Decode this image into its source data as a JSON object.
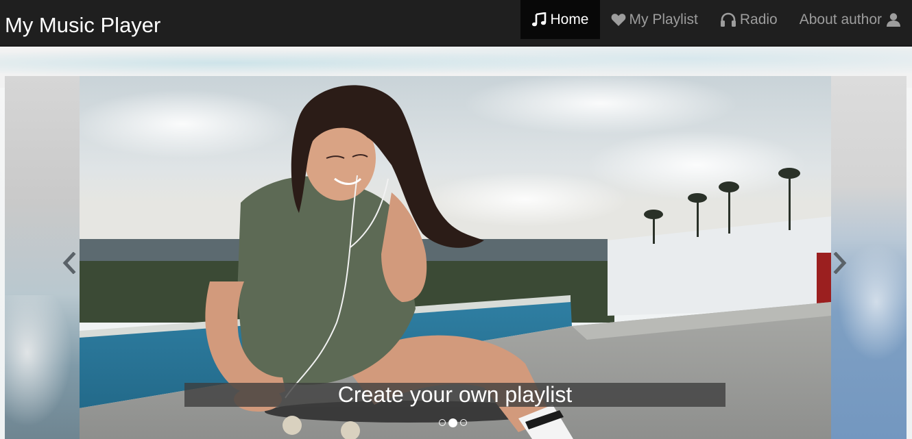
{
  "brand": {
    "title": "My Music Player"
  },
  "nav": {
    "items": [
      {
        "label": "Home",
        "icon": "music-note-icon",
        "active": true
      },
      {
        "label": "My Playlist",
        "icon": "heart-icon",
        "active": false
      },
      {
        "label": "Radio",
        "icon": "headphones-icon",
        "active": false
      },
      {
        "label": "About author",
        "icon": "user-icon",
        "active": false
      }
    ]
  },
  "carousel": {
    "caption": "Create your own playlist",
    "active_slide": 2,
    "slide_count": 3,
    "prev_icon": "chevron-left-icon",
    "next_icon": "chevron-right-icon"
  },
  "colors": {
    "navbar_bg": "#1f1f1f",
    "nav_active_bg": "#080808",
    "nav_text": "#9d9d9d",
    "nav_text_active": "#ffffff",
    "caption_bg": "#3c3c3c"
  }
}
